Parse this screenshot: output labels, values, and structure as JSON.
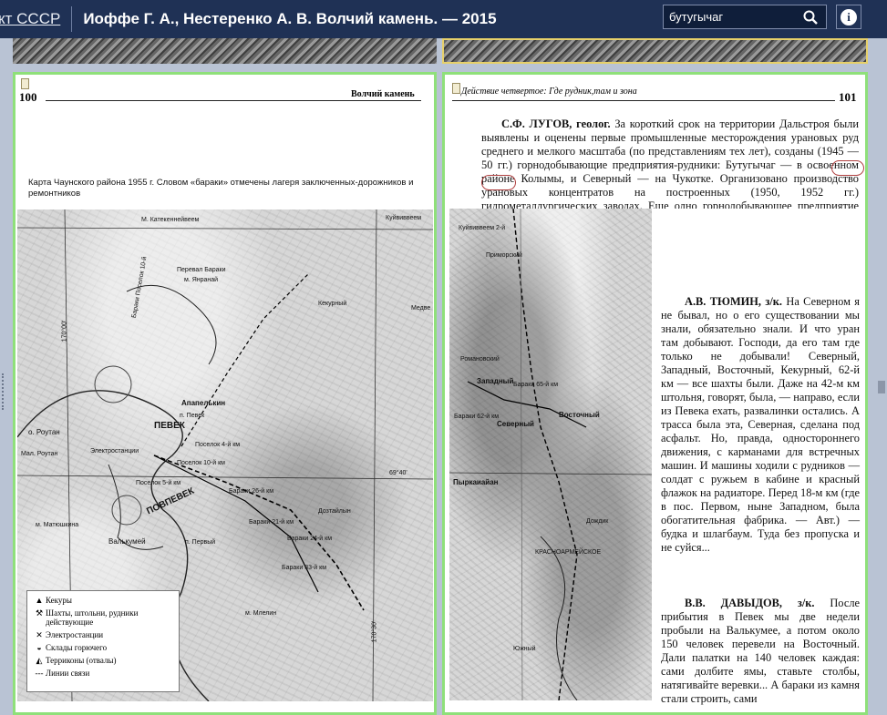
{
  "header": {
    "brand": "кт СССР",
    "title": "Иоффе Г. А., Нестеренко А. В. Волчий камень. — 2015",
    "search_value": "бутугычаг",
    "info_label": "i"
  },
  "left_page": {
    "page_number": "100",
    "running_head": "Волчий камень",
    "caption": "Карта Чаунского района 1955 г. Словом «бараки» отмечены лагеря заключенных-дорожников и ремонтников",
    "map_labels": {
      "katekenneyveem": "М. Катекеннейвеем",
      "kuyviveem": "Куйвиввеем",
      "pereval_baraki": "Перевал Бараки",
      "yanranay": "м. Янранай",
      "baraki_poselok": "Бараки Поселок 10-й",
      "kekurny": "Кекурный",
      "apapelkhin": "Апапелькин",
      "pevek": "ПЕВЕК",
      "p_pevek": "п. Певек",
      "roytan": "о. Роутан",
      "mal_roytan": "Мал. Роутан",
      "elektrostantsii": "Электростанции",
      "poselok_4": "Поселок 4-й км",
      "poselok_5": "Поселок 5-й км",
      "poselok_10": "Поселок 10-й км",
      "povpevek": "ПОВПЕВЕК",
      "matyushkina": "м. Матюшкина",
      "valkumey": "Валькумей",
      "pervy": "п. Первый",
      "baraki_26": "Бараки 26-й км",
      "baraki_21": "Бараки 21-й км",
      "baraki_24": "Бараки 24-й км",
      "baraki_33": "Бараки 33-й км",
      "mplpin": "м. Млелин",
      "grid_left": "170°00'",
      "grid_right": "69°40'",
      "grid_lat": "170°30'",
      "dozhdik": "Дозтайлын",
      "medve": "Медве"
    },
    "legend": [
      {
        "symbol": "▲",
        "label": "Кекуры"
      },
      {
        "symbol": "⚒",
        "label": "Шахты, штольни, рудники действующие"
      },
      {
        "symbol": "✕",
        "label": "Электростанции"
      },
      {
        "symbol": "◒",
        "label": "Склады горючего"
      },
      {
        "symbol": "◭",
        "label": "Терриконы (отвалы)"
      },
      {
        "symbol": "---",
        "label": "Линии связи"
      }
    ]
  },
  "right_page": {
    "page_number": "101",
    "running_head": "Действие четвертое: Где рудник,там и зона",
    "paragraph_top": {
      "speaker": "С.Ф. ЛУГОВ, геолог.",
      "text": " За короткий срок на территории Дальстроя были выявлены и оценены первые промышленные месторождения урановых руд среднего и мелкого масштаба (по представлениям тех лет), созданы (1945 — 50 гг.) горнодобывающие предприятия-рудники: Бутугычаг — в освоенном районе Колымы, и Северный — на Чукотке. Организовано производство урановых концентратов на построенных (1950, 1952 гг.) гидрометаллургических заводах. Еще одно горнодобывающее предприятие — Сугун — находилось в стадии строительства в новом, труднодоступном районе Колымы."
    },
    "paragraph_tyumin": {
      "speaker": "А.В. ТЮМИН, з/к.",
      "text": " На Северном я не бывал, но о его существовании мы знали, обязательно знали. И что уран там добывают. Господи, да его там где только не добывали! Северный, Западный, Восточный, Кекурный, 62-й км — все шахты были. Даже на 42-м км штольня, говорят, была, — направо, если из Певека ехать, развалинки остались. А трасса была эта, Северная, сделана под асфальт. Но, правда, одностороннего движения, с карманами для встречных машин. И машины ходили с рудников — солдат с ружьем в кабине и красный флажок на радиаторе. Перед 18-м км (где в пос. Первом, ныне Западном, была обогатительная фабрика. — Авт.) — будка и шлагбаум. Туда без пропуска и не суйся..."
    },
    "paragraph_davydov": {
      "speaker": "В.В. ДАВЫДОВ, з/к.",
      "text": " После прибытия в Певек мы две недели пробыли на Валькумее, а потом около 150 человек перевели на Восточный. Дали палатки на 140 человек каждая: сами долбите ямы, ставьте столбы, натягивайте веревки... А бараки из камня стали строить, сами"
    },
    "map_labels": {
      "kuyviveem2": "Куйвиввеем 2-й",
      "primorsky": "Приморский",
      "romanovsky": "Романовский",
      "zapadny": "Западный",
      "baraki_65": "Бараки 65-й км",
      "vostochny": "Восточный",
      "severny": "Северный",
      "baraki_62": "Бараки 62-й км",
      "pyrkanayan": "Пыркаиайан",
      "krasnoarmeyskoe": "КРАСНОАРМЕЙСКОЕ",
      "yuzhny": "Южный",
      "dozhdik": "Дождик"
    }
  }
}
